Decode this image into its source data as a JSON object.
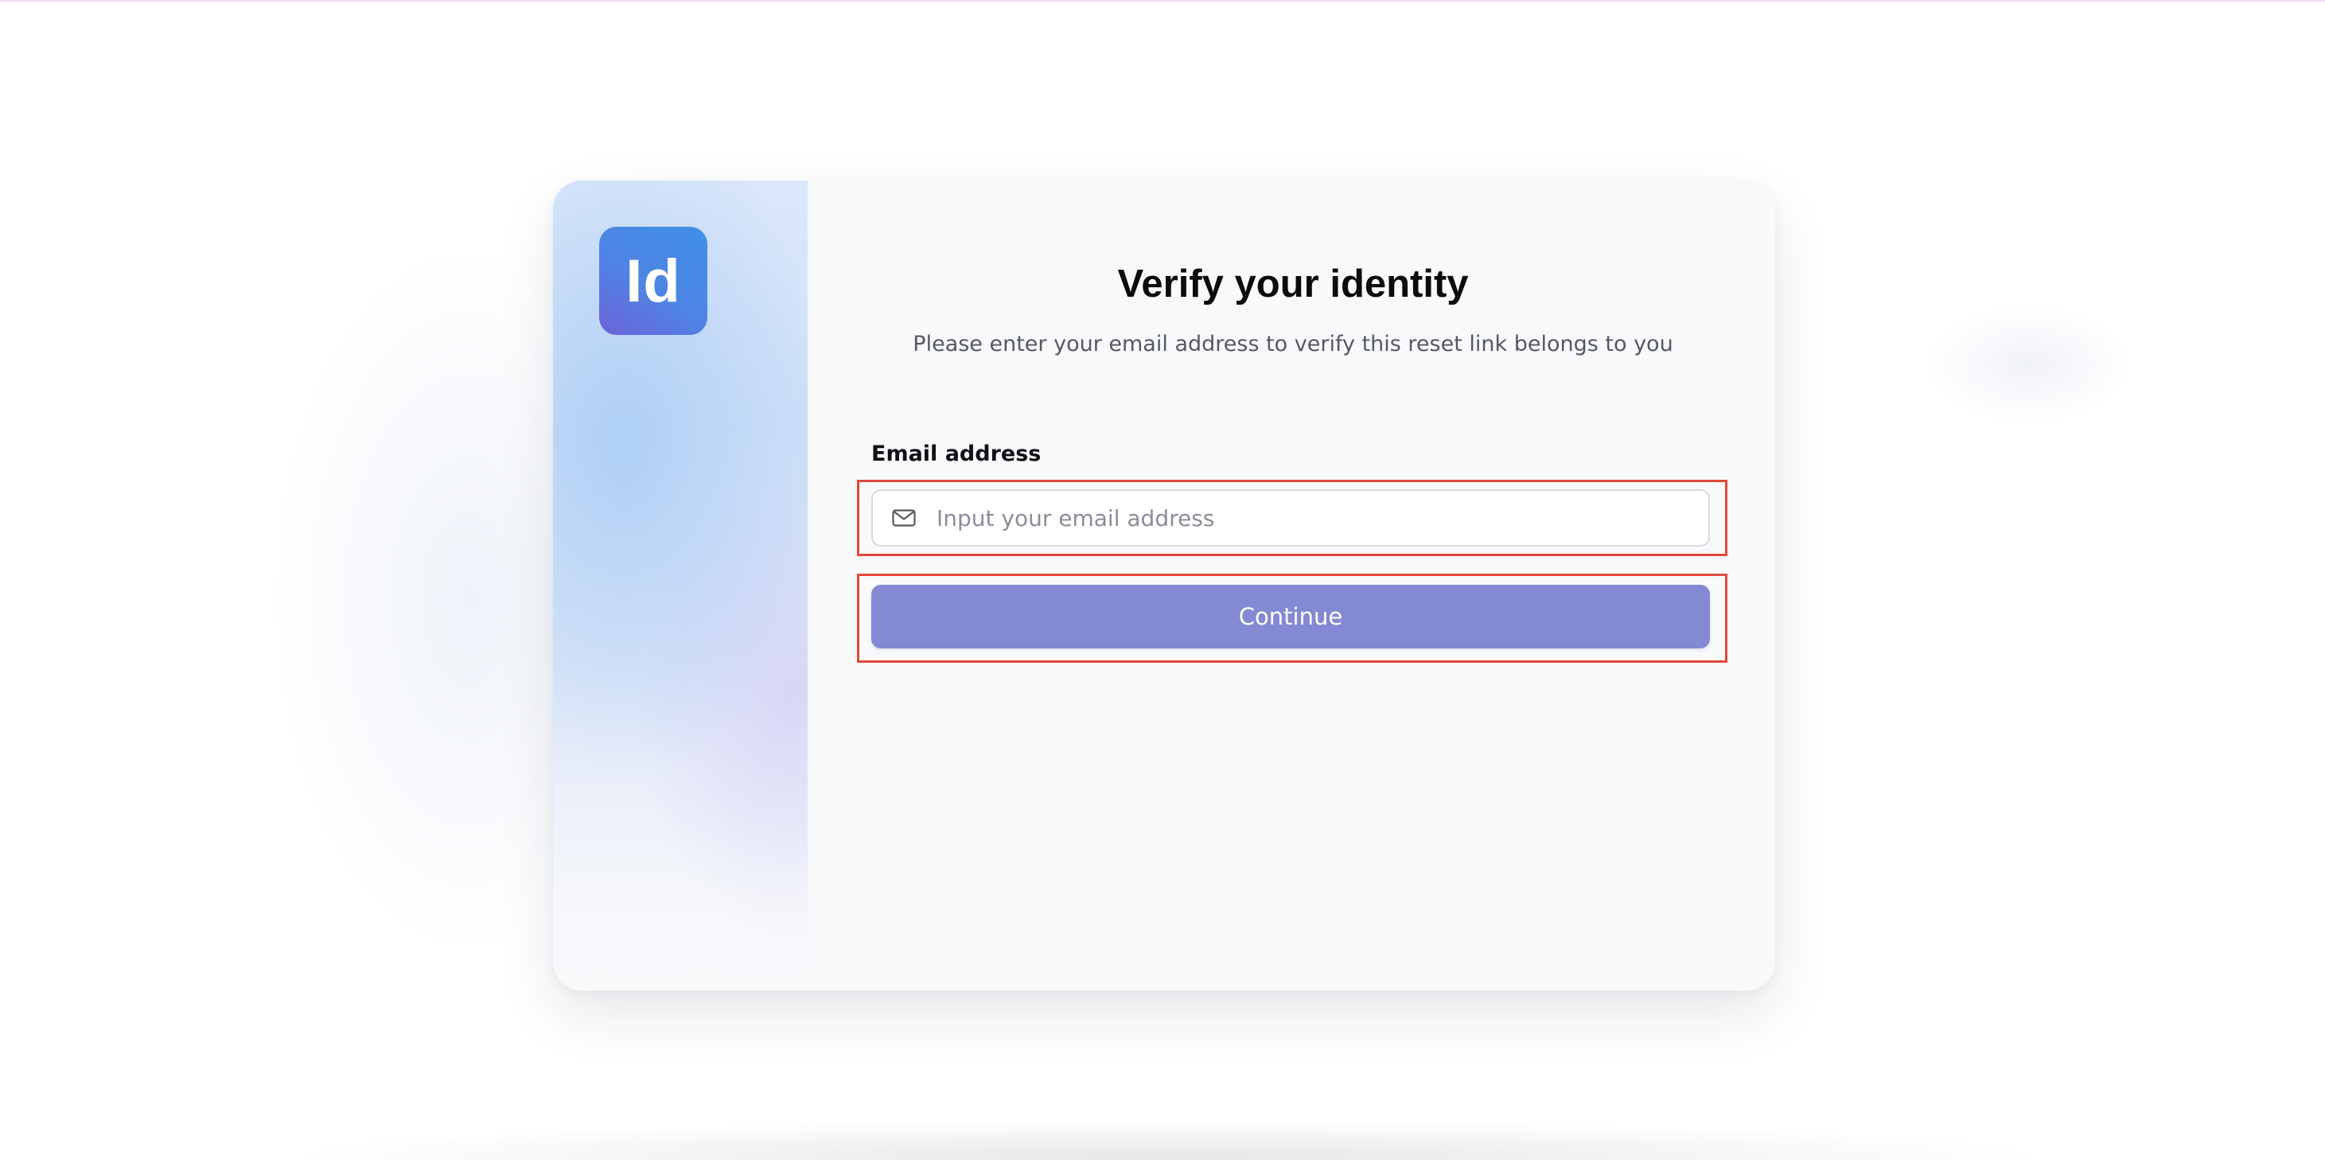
{
  "brand": {
    "logo_text": "Id",
    "logo_colors": [
      "#6d62d6",
      "#3f90e8"
    ]
  },
  "form": {
    "title": "Verify your identity",
    "subtitle": "Please enter your email address to verify this reset link belongs to you",
    "email": {
      "label": "Email address",
      "value": "",
      "placeholder": "Input your email address",
      "icon": "mail-icon"
    },
    "submit_label": "Continue"
  },
  "colors": {
    "button": "#8489d3",
    "highlight_frame": "#e04a3c"
  }
}
